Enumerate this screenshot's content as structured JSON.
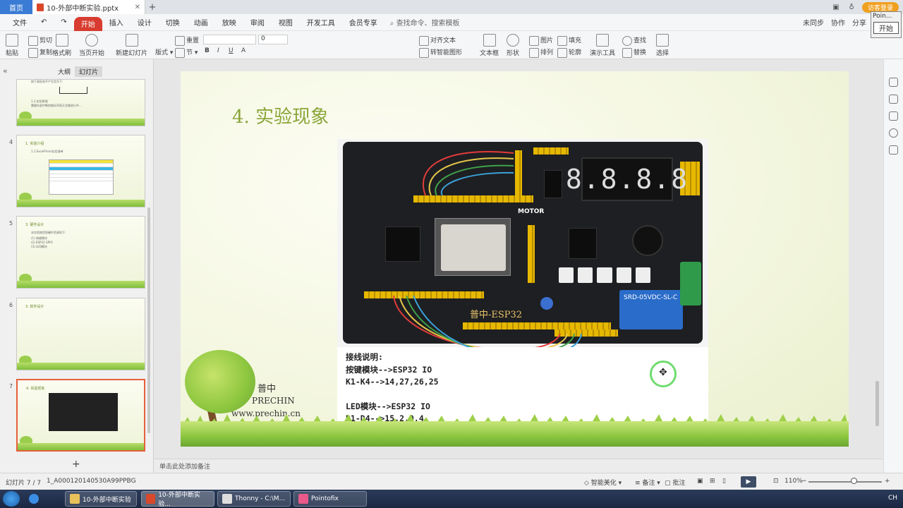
{
  "titlebar": {
    "home_tab": "首页",
    "doc_tab": "10-外部中断实验.pptx",
    "visitor": "访客登录"
  },
  "menu": {
    "file": "文件",
    "items": [
      "开始",
      "插入",
      "设计",
      "切换",
      "动画",
      "放映",
      "审阅",
      "视图",
      "开发工具",
      "会员专享"
    ],
    "search": "查找命令、搜索模板",
    "right": [
      "未同步",
      "协作",
      "分享"
    ]
  },
  "toolbar": {
    "paste": "粘贴",
    "cut": "剪切",
    "copy": "复制",
    "format_painter": "格式刷",
    "from_current": "当页开始",
    "new_slide": "新建幻灯片",
    "layout": "版式",
    "section": "节",
    "reset": "重置",
    "font_size": "0",
    "align_text": "对齐文本",
    "smart_graphic": "转智能图形",
    "textbox": "文本框",
    "shape": "形状",
    "picture": "图片",
    "fill": "填充",
    "arrange": "排列",
    "outline": "轮廓",
    "slideshow_tools": "演示工具",
    "find": "查找",
    "replace": "替换",
    "select": "选择"
  },
  "pointofix": {
    "title": "Poin...",
    "button": "开始"
  },
  "leftpane": {
    "tab_outline": "大纲",
    "tab_slides": "幻灯片",
    "thumbs": [
      {
        "num": "",
        "title": "",
        "lines": [
          "按下高低电平产生信号下:",
          "1.3 实验原理",
          "需要外部中断控制LED亮灭交替进行中..."
        ]
      },
      {
        "num": "4",
        "title": "1. 实验介绍",
        "lines": [
          "1.1 ExcelPrime实验清单"
        ]
      },
      {
        "num": "5",
        "title": "3. 硬件设计",
        "lines": [
          "本实验使用到硬件资源如下:",
          "(1) 按键模块",
          "(2) ESP32 GPIO",
          "(3) LED模块"
        ]
      },
      {
        "num": "6",
        "title": "3. 软件设计",
        "lines": []
      },
      {
        "num": "7",
        "title": "4. 实验现象",
        "lines": []
      }
    ]
  },
  "slide": {
    "title": "4. 实验现象",
    "brand_cn": "普中",
    "brand_en": "PRECHIN",
    "brand_url": "www.prechin.cn",
    "board_label": "普中-ESP32",
    "motor_label": "MOTOR",
    "seg_display": "8.8.8.8",
    "relay_text": "SRD-05VDC-SL-C",
    "wiring": [
      "接线说明:",
      "按键模块-->ESP32 IO",
      "K1-K4-->14,27,26,25",
      "",
      "LED模块-->ESP32 IO",
      "D1-D4-->15,2,0,4"
    ]
  },
  "notes_placeholder": "单击此处添加备注",
  "statusbar": {
    "slide_counter": "幻灯片 7 / 7",
    "theme": "1_A000120140530A99PPBG",
    "smart_beautify": "智能美化",
    "notes": "备注",
    "comments": "批注",
    "zoom": "110%"
  },
  "taskbar": {
    "items": [
      "10-外部中断实验",
      "10-外部中断实验...",
      "Thonny - C:\\M...",
      "Pointofix"
    ],
    "tray": "CH"
  },
  "colors": {
    "accent": "#d83b2f",
    "title_green": "#8aa63a",
    "selection": "#e6603b"
  }
}
